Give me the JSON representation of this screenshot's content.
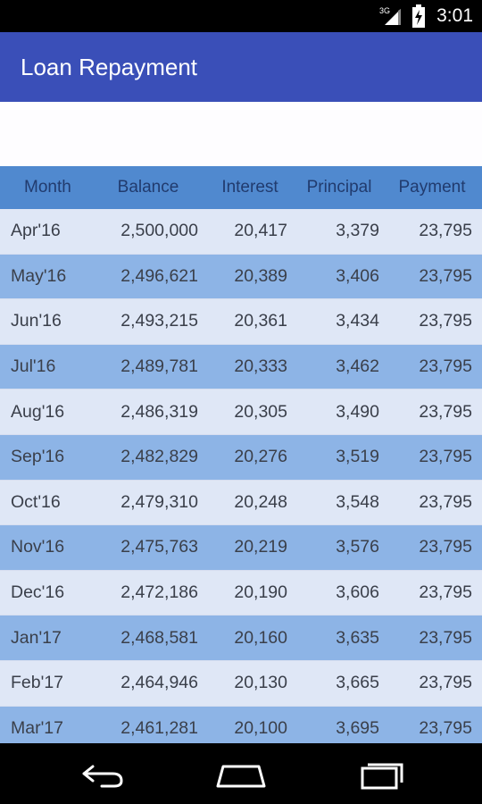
{
  "status_bar": {
    "time": "3:01",
    "network_label": "3G",
    "icons": [
      "signal-icon",
      "battery-icon"
    ]
  },
  "app_bar": {
    "title": "Loan Repayment"
  },
  "table": {
    "headers": [
      "Month",
      "Balance",
      "Interest",
      "Principal",
      "Payment"
    ],
    "rows": [
      [
        "Apr'16",
        "2,500,000",
        "20,417",
        "3,379",
        "23,795"
      ],
      [
        "May'16",
        "2,496,621",
        "20,389",
        "3,406",
        "23,795"
      ],
      [
        "Jun'16",
        "2,493,215",
        "20,361",
        "3,434",
        "23,795"
      ],
      [
        "Jul'16",
        "2,489,781",
        "20,333",
        "3,462",
        "23,795"
      ],
      [
        "Aug'16",
        "2,486,319",
        "20,305",
        "3,490",
        "23,795"
      ],
      [
        "Sep'16",
        "2,482,829",
        "20,276",
        "3,519",
        "23,795"
      ],
      [
        "Oct'16",
        "2,479,310",
        "20,248",
        "3,548",
        "23,795"
      ],
      [
        "Nov'16",
        "2,475,763",
        "20,219",
        "3,576",
        "23,795"
      ],
      [
        "Dec'16",
        "2,472,186",
        "20,190",
        "3,606",
        "23,795"
      ],
      [
        "Jan'17",
        "2,468,581",
        "20,160",
        "3,635",
        "23,795"
      ],
      [
        "Feb'17",
        "2,464,946",
        "20,130",
        "3,665",
        "23,795"
      ],
      [
        "Mar'17",
        "2,461,281",
        "20,100",
        "3,695",
        "23,795"
      ]
    ]
  },
  "nav_bar": {
    "icons": [
      "back-icon",
      "home-icon",
      "recents-icon"
    ]
  },
  "colors": {
    "app_bar": "#3a4fb8",
    "table_header": "#5089cf",
    "row_light": "#dfe7f6",
    "row_dark": "#8db4e6"
  }
}
